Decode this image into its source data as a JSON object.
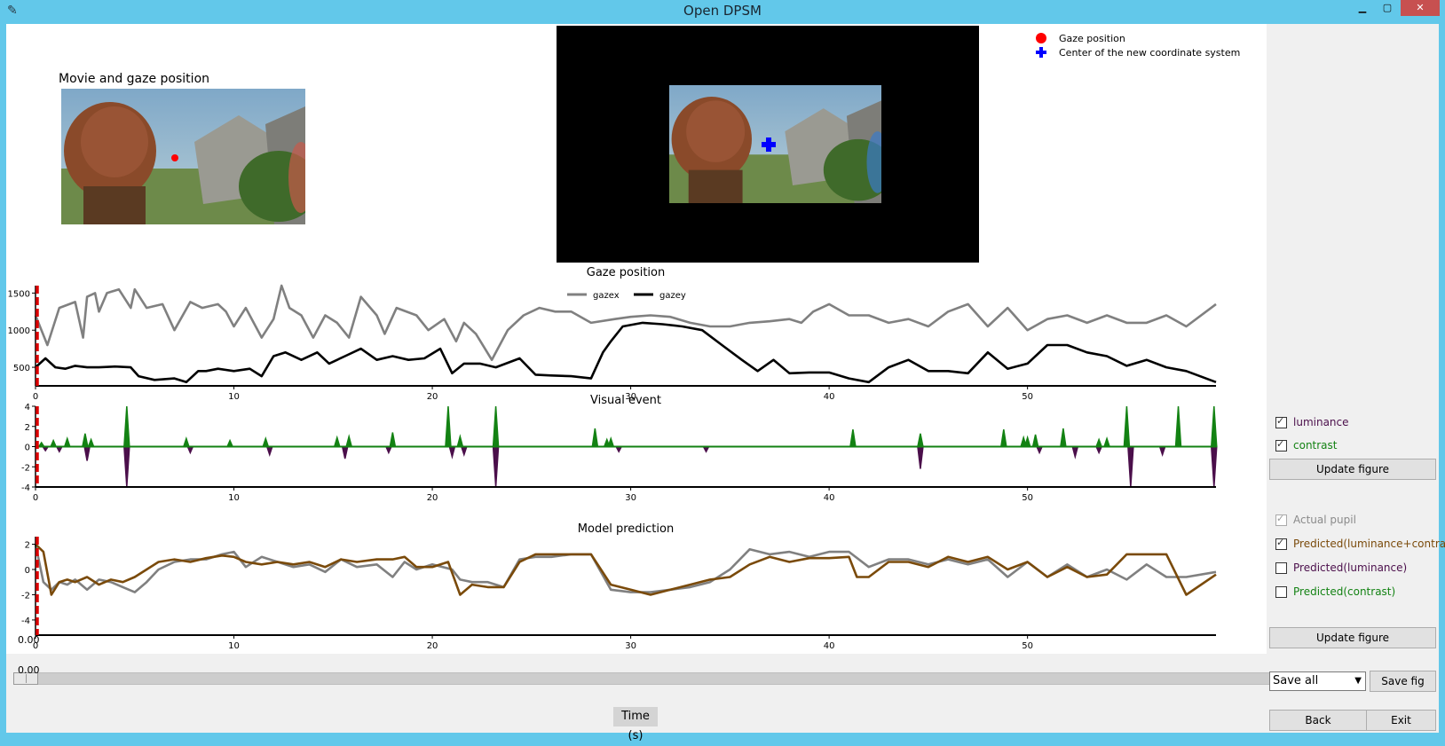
{
  "window": {
    "title": "Open DPSM",
    "min_glyph": "▁",
    "max_glyph": "▢",
    "close_glyph": "✕"
  },
  "figure": {
    "movie_title": "Movie and gaze position",
    "legend": {
      "gaze": "Gaze position",
      "center": "Center of the new coordinate system"
    },
    "colors": {
      "gaze_marker": "#ff0000",
      "center_marker": "#0000ff",
      "gazex": "#808080",
      "gazey": "#000000",
      "luminance": "#4b0f4b",
      "contrast": "#138213",
      "actual": "#808080",
      "predicted": "#7a4a0a",
      "cursor": "#dd0000"
    }
  },
  "chart_data": [
    {
      "type": "line",
      "title": "Gaze position",
      "ylim": [
        250,
        1600
      ],
      "xlim": [
        0,
        59.5
      ],
      "x_ticks": [
        "0",
        "10",
        "20",
        "30",
        "40",
        "50"
      ],
      "y_ticks": [
        "500",
        "1000",
        "1500"
      ],
      "series": [
        {
          "name": "gazex",
          "x": [
            0,
            0.6,
            1.2,
            2.0,
            2.4,
            2.6,
            3.0,
            3.2,
            3.6,
            4.2,
            4.8,
            5.0,
            5.6,
            6.4,
            7.0,
            7.8,
            8.4,
            9.2,
            9.6,
            10.0,
            10.6,
            11.4,
            12.0,
            12.4,
            12.8,
            13.4,
            14.0,
            14.6,
            15.2,
            15.8,
            16.4,
            17.2,
            17.6,
            18.2,
            19.2,
            19.8,
            20.6,
            21.2,
            21.6,
            22.2,
            23.0,
            23.8,
            24.6,
            25.4,
            26.2,
            27.0,
            28.0,
            29.2,
            30.0,
            31.0,
            32.0,
            33.0,
            34.0,
            35.0,
            36.0,
            37.0,
            38.0,
            38.6,
            39.2,
            40.0,
            41.0,
            42.0,
            43.0,
            44.0,
            45.0,
            46.0,
            47.0,
            48.0,
            49.0,
            50.0,
            51.0,
            52.0,
            53.0,
            54.0,
            55.0,
            56.0,
            57.0,
            58.0,
            59.5
          ],
          "y": [
            1200,
            800,
            1300,
            1380,
            900,
            1450,
            1500,
            1250,
            1500,
            1550,
            1300,
            1550,
            1300,
            1350,
            1000,
            1380,
            1300,
            1350,
            1250,
            1050,
            1300,
            900,
            1150,
            1600,
            1300,
            1200,
            900,
            1200,
            1100,
            900,
            1450,
            1200,
            950,
            1300,
            1200,
            1000,
            1150,
            850,
            1100,
            950,
            600,
            1000,
            1200,
            1300,
            1250,
            1250,
            1100,
            1150,
            1180,
            1200,
            1180,
            1100,
            1050,
            1050,
            1100,
            1120,
            1150,
            1100,
            1250,
            1350,
            1200,
            1200,
            1100,
            1150,
            1050,
            1250,
            1350,
            1050,
            1300,
            1000,
            1150,
            1200,
            1100,
            1200,
            1100,
            1100,
            1200,
            1050,
            1350
          ]
        },
        {
          "name": "gazey",
          "x": [
            0,
            0.5,
            1.0,
            1.5,
            2.0,
            2.6,
            3.2,
            4.0,
            4.8,
            5.2,
            6.0,
            7.0,
            7.6,
            8.2,
            8.6,
            9.2,
            10.0,
            10.8,
            11.4,
            12.0,
            12.6,
            13.4,
            14.2,
            14.8,
            15.6,
            16.4,
            17.2,
            18.0,
            18.8,
            19.6,
            20.4,
            21.0,
            21.6,
            22.4,
            23.2,
            24.4,
            25.2,
            26.0,
            27.0,
            28.0,
            28.6,
            29.0,
            29.6,
            30.6,
            31.6,
            32.6,
            33.6,
            34.6,
            35.6,
            36.4,
            37.2,
            38.0,
            39.0,
            40.0,
            41.0,
            42.0,
            43.0,
            44.0,
            45.0,
            46.0,
            47.0,
            48.0,
            49.0,
            50.0,
            51.0,
            52.0,
            53.0,
            54.0,
            55.0,
            56.0,
            57.0,
            58.0,
            59.5
          ],
          "y": [
            500,
            620,
            500,
            480,
            520,
            500,
            500,
            510,
            500,
            380,
            330,
            350,
            300,
            450,
            450,
            480,
            450,
            480,
            380,
            650,
            700,
            600,
            700,
            550,
            650,
            750,
            600,
            650,
            600,
            620,
            750,
            420,
            550,
            550,
            500,
            620,
            400,
            390,
            380,
            350,
            700,
            850,
            1050,
            1100,
            1080,
            1050,
            1000,
            800,
            600,
            450,
            600,
            420,
            430,
            430,
            350,
            300,
            500,
            600,
            450,
            450,
            420,
            700,
            480,
            550,
            800,
            800,
            700,
            650,
            520,
            600,
            500,
            450,
            300
          ]
        }
      ]
    },
    {
      "type": "line",
      "title": "Visual event",
      "ylim": [
        -4,
        4
      ],
      "xlim": [
        0,
        59.5
      ],
      "x_ticks": [
        "0",
        "10",
        "20",
        "30",
        "40",
        "50"
      ],
      "y_ticks": [
        "4",
        "2",
        "0",
        "-2",
        "-4"
      ],
      "series": [
        {
          "name": "luminance",
          "spikes": [
            [
              0.5,
              -0.4
            ],
            [
              1.2,
              -0.5
            ],
            [
              2.6,
              -1.4
            ],
            [
              4.6,
              -4
            ],
            [
              7.8,
              -0.6
            ],
            [
              11.8,
              -0.8
            ],
            [
              15.6,
              -1.2
            ],
            [
              17.8,
              -0.6
            ],
            [
              21.0,
              -1.0
            ],
            [
              21.6,
              -0.8
            ],
            [
              23.2,
              -4
            ],
            [
              29.4,
              -0.5
            ],
            [
              33.8,
              -0.5
            ],
            [
              44.6,
              -2.2
            ],
            [
              50.6,
              -0.6
            ],
            [
              52.4,
              -1.0
            ],
            [
              53.6,
              -0.6
            ],
            [
              55.2,
              -4
            ],
            [
              56.8,
              -0.8
            ],
            [
              59.4,
              -4
            ]
          ]
        },
        {
          "name": "contrast",
          "spikes": [
            [
              0.3,
              0.4
            ],
            [
              0.9,
              0.6
            ],
            [
              1.6,
              0.8
            ],
            [
              2.5,
              1.3
            ],
            [
              2.8,
              0.7
            ],
            [
              4.6,
              4
            ],
            [
              7.6,
              0.8
            ],
            [
              9.8,
              0.6
            ],
            [
              11.6,
              0.8
            ],
            [
              15.2,
              0.9
            ],
            [
              15.8,
              1.0
            ],
            [
              18.0,
              1.4
            ],
            [
              20.8,
              4
            ],
            [
              21.4,
              1.0
            ],
            [
              23.2,
              4
            ],
            [
              28.2,
              1.8
            ],
            [
              28.8,
              0.7
            ],
            [
              29.0,
              0.8
            ],
            [
              41.2,
              1.7
            ],
            [
              44.6,
              1.3
            ],
            [
              48.8,
              1.7
            ],
            [
              49.8,
              0.9
            ],
            [
              50.0,
              0.9
            ],
            [
              50.4,
              1.2
            ],
            [
              51.8,
              1.8
            ],
            [
              53.6,
              0.7
            ],
            [
              54.0,
              0.8
            ],
            [
              55.0,
              4
            ],
            [
              57.6,
              4
            ],
            [
              59.4,
              4
            ]
          ]
        }
      ]
    },
    {
      "type": "line",
      "title": "Model prediction",
      "ylim": [
        -5.2,
        2.6
      ],
      "xlim": [
        0,
        59.5
      ],
      "x_ticks": [
        "0",
        "10",
        "20",
        "30",
        "40",
        "50"
      ],
      "y_ticks": [
        "2",
        "0",
        "-2",
        "-4"
      ],
      "series": [
        {
          "name": "Actual pupil",
          "x": [
            0,
            0.4,
            0.8,
            1.2,
            1.6,
            2.0,
            2.6,
            3.2,
            3.8,
            4.4,
            5.0,
            5.6,
            6.2,
            7.0,
            7.8,
            8.6,
            9.4,
            10.0,
            10.6,
            11.4,
            12.2,
            13.0,
            13.8,
            14.6,
            15.4,
            16.2,
            17.2,
            18.0,
            18.6,
            19.2,
            20.0,
            21.0,
            21.4,
            22.0,
            22.8,
            23.6,
            24.4,
            25.2,
            26.0,
            27.0,
            28.0,
            29.0,
            30.0,
            31.0,
            32.0,
            33.0,
            34.0,
            35.0,
            36.0,
            37.0,
            38.0,
            39.0,
            40.0,
            41.0,
            42.0,
            43.0,
            44.0,
            45.0,
            46.0,
            47.0,
            48.0,
            49.0,
            50.0,
            51.0,
            52.0,
            53.0,
            54.0,
            55.0,
            56.0,
            57.0,
            58.0,
            59.5
          ],
          "y": [
            2.0,
            -1.0,
            -1.6,
            -1.0,
            -1.2,
            -0.8,
            -1.6,
            -0.8,
            -1.0,
            -1.4,
            -1.8,
            -1.0,
            0.0,
            0.6,
            0.8,
            0.8,
            1.2,
            1.4,
            0.2,
            1.0,
            0.6,
            0.2,
            0.4,
            -0.2,
            0.8,
            0.2,
            0.4,
            -0.6,
            0.6,
            0.0,
            0.4,
            0.0,
            -0.8,
            -1.0,
            -1.0,
            -1.4,
            0.8,
            1.0,
            1.0,
            1.2,
            1.2,
            -1.6,
            -1.8,
            -1.8,
            -1.6,
            -1.4,
            -1.0,
            0.0,
            1.6,
            1.2,
            1.4,
            1.0,
            1.4,
            1.4,
            0.2,
            0.8,
            0.8,
            0.4,
            0.8,
            0.4,
            0.8,
            -0.6,
            0.6,
            -0.6,
            0.4,
            -0.6,
            0.0,
            -0.8,
            0.4,
            -0.6,
            -0.6,
            -0.2
          ]
        },
        {
          "name": "Predicted(luminance+contrast)",
          "x": [
            0,
            0.4,
            0.8,
            1.2,
            1.6,
            2.0,
            2.6,
            3.2,
            3.8,
            4.4,
            5.0,
            5.6,
            6.2,
            7.0,
            7.8,
            8.6,
            9.4,
            10.0,
            10.6,
            11.4,
            12.2,
            13.0,
            13.8,
            14.6,
            15.4,
            16.2,
            17.2,
            18.0,
            18.6,
            19.2,
            20.0,
            20.8,
            21.4,
            22.0,
            22.8,
            23.6,
            24.4,
            25.2,
            26.0,
            27.0,
            28.0,
            29.0,
            30.0,
            31.0,
            32.0,
            33.0,
            34.0,
            35.0,
            36.0,
            37.0,
            38.0,
            39.0,
            40.0,
            41.0,
            41.4,
            42.0,
            43.0,
            44.0,
            45.0,
            46.0,
            47.0,
            48.0,
            49.0,
            50.0,
            51.0,
            52.0,
            53.0,
            54.0,
            55.0,
            56.0,
            57.0,
            58.0,
            59.5
          ],
          "y": [
            2.0,
            1.4,
            -2.0,
            -1.0,
            -0.8,
            -1.0,
            -0.6,
            -1.2,
            -0.8,
            -1.0,
            -0.6,
            0.0,
            0.6,
            0.8,
            0.6,
            0.9,
            1.1,
            1.0,
            0.6,
            0.4,
            0.6,
            0.4,
            0.6,
            0.2,
            0.8,
            0.6,
            0.8,
            0.8,
            1.0,
            0.2,
            0.2,
            0.6,
            -2.0,
            -1.2,
            -1.4,
            -1.4,
            0.6,
            1.2,
            1.2,
            1.2,
            1.2,
            -1.2,
            -1.6,
            -2.0,
            -1.6,
            -1.2,
            -0.8,
            -0.6,
            0.4,
            1.0,
            0.6,
            0.9,
            0.9,
            1.0,
            -0.6,
            -0.6,
            0.6,
            0.6,
            0.2,
            1.0,
            0.6,
            1.0,
            0.0,
            0.6,
            -0.6,
            0.2,
            -0.6,
            -0.4,
            1.2,
            1.2,
            1.2,
            -2.0,
            -0.4
          ]
        }
      ]
    }
  ],
  "side": {
    "events_checks": [
      {
        "label": "luminance",
        "checked": true,
        "color": "#4b0f4b"
      },
      {
        "label": "contrast",
        "checked": true,
        "color": "#138213"
      }
    ],
    "update1": "Update figure",
    "model_checks": [
      {
        "label": "Actual pupil",
        "checked": true,
        "disabled": true,
        "color": "#8a8a8a"
      },
      {
        "label": "Predicted(luminance+contrast)",
        "checked": true,
        "color": "#7a4a0a"
      },
      {
        "label": "Predicted(luminance)",
        "checked": false,
        "color": "#4b0f4b"
      },
      {
        "label": "Predicted(contrast)",
        "checked": false,
        "color": "#138213"
      }
    ],
    "update2": "Update figure",
    "save_select": "Save all",
    "save_fig": "Save fig",
    "back": "Back",
    "exit": "Exit"
  },
  "slider": {
    "value_top": "0.00",
    "value_bottom": "0.00",
    "fraction": 0.0
  },
  "time_label": "Time (s)"
}
